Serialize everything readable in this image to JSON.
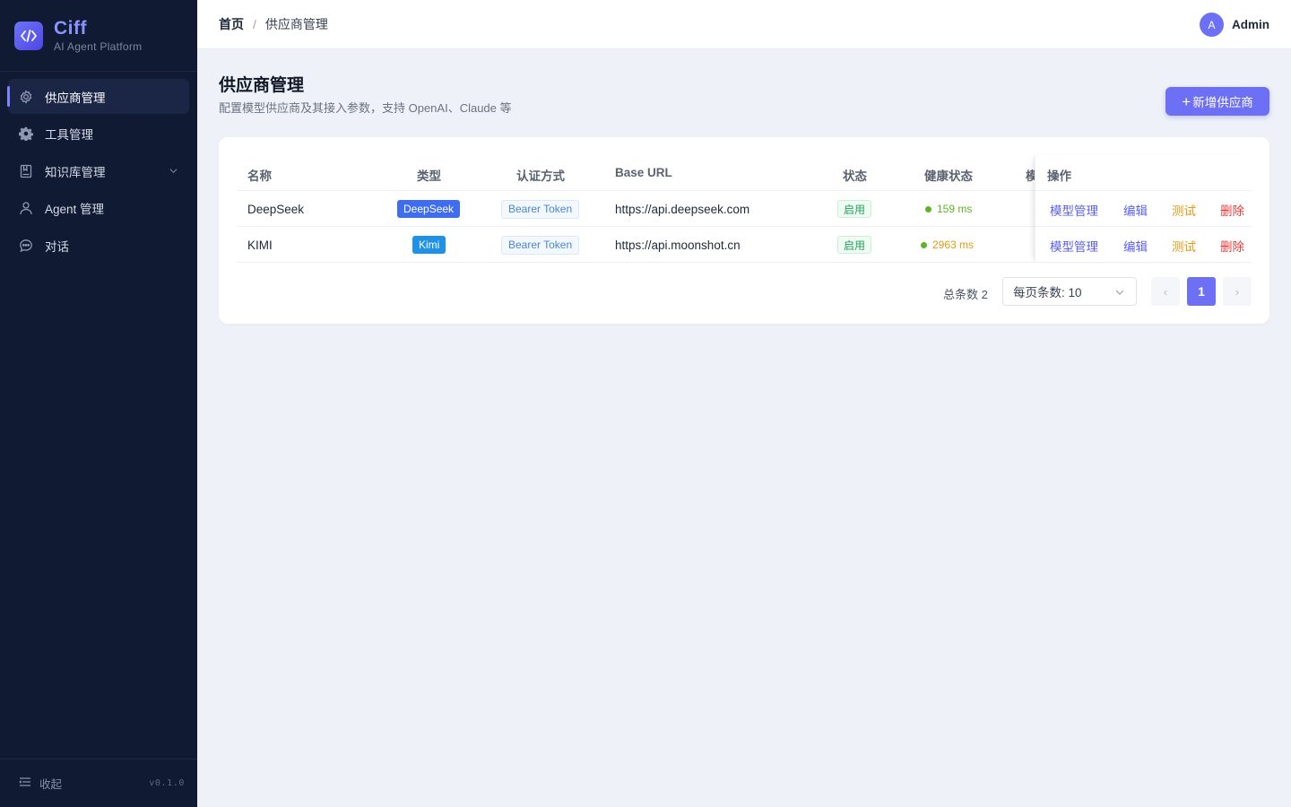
{
  "brand": {
    "name": "Ciff",
    "subtitle": "AI Agent Platform"
  },
  "sidebar": {
    "items": [
      {
        "label": "供应商管理",
        "icon": "gear-icon",
        "active": true
      },
      {
        "label": "工具管理",
        "icon": "cog-icon",
        "active": false
      },
      {
        "label": "知识库管理",
        "icon": "book-icon",
        "active": false,
        "expandable": true
      },
      {
        "label": "Agent 管理",
        "icon": "user-icon",
        "active": false
      },
      {
        "label": "对话",
        "icon": "chat-icon",
        "active": false
      }
    ],
    "collapse_label": "收起",
    "version": "v0.1.0"
  },
  "header": {
    "breadcrumb_home": "首页",
    "breadcrumb_sep": "/",
    "breadcrumb_current": "供应商管理",
    "user_initial": "A",
    "user_name": "Admin"
  },
  "page": {
    "title": "供应商管理",
    "description": "配置模型供应商及其接入参数，支持 OpenAI、Claude 等",
    "add_button_label": "新增供应商"
  },
  "table": {
    "columns": [
      "名称",
      "类型",
      "认证方式",
      "Base URL",
      "状态",
      "健康状态",
      "模",
      "操作"
    ],
    "rows": [
      {
        "name": "DeepSeek",
        "type": "DeepSeek",
        "type_color": "#3f6df2",
        "auth": "Bearer Token",
        "base_url": "https://api.deepseek.com",
        "status": "启用",
        "health": "159 ms",
        "health_color": "#5fb327",
        "health_text_color": "#5fb327"
      },
      {
        "name": "KIMI",
        "type": "Kimi",
        "type_color": "#1f91e6",
        "auth": "Bearer Token",
        "base_url": "https://api.moonshot.cn",
        "status": "启用",
        "health": "2963 ms",
        "health_color": "#5fb327",
        "health_text_color": "#e69a11"
      }
    ],
    "actions": {
      "models": "模型管理",
      "edit": "编辑",
      "test": "测试",
      "delete": "删除"
    }
  },
  "pagination": {
    "total_label": "总条数 2",
    "page_size_label": "每页条数: 10",
    "current_page": "1",
    "prev": "‹",
    "next": "›"
  },
  "colors": {
    "accent": "#6d6ff5",
    "sidebar_bg": "#111a33",
    "page_bg": "#eef2f8"
  }
}
